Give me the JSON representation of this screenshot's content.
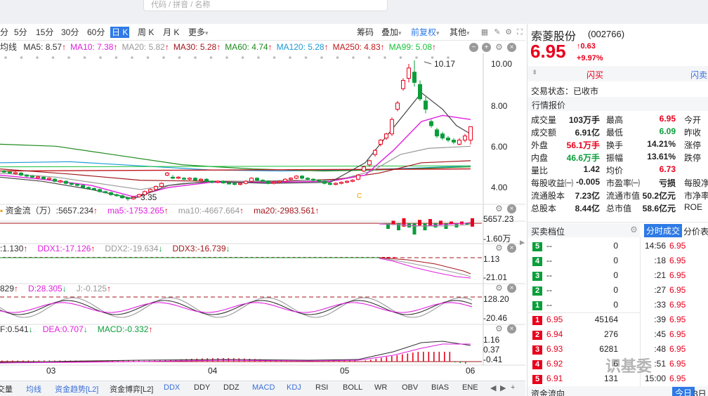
{
  "search": {
    "placeholder": "代码 / 拼音 / 名称"
  },
  "toolbar": {
    "periods": [
      "分",
      "5分",
      "15分",
      "30分",
      "60分",
      "日 K",
      "周 K",
      "月 K",
      "更多"
    ],
    "active_period": "日 K",
    "tools": [
      "筹码",
      "叠加",
      "前复权",
      "其他"
    ],
    "more_caret": "▾"
  },
  "ma_row": {
    "lead": "均线",
    "items": [
      {
        "label": "MA5: 8.57",
        "arrow": "↑",
        "color": "#333333"
      },
      {
        "label": "MA10: 7.38",
        "arrow": "↑",
        "color": "#e01ee0"
      },
      {
        "label": "MA20: 5.82",
        "arrow": "↑",
        "color": "#999999"
      },
      {
        "label": "MA30: 5.28",
        "arrow": "↑",
        "color": "#a3171c"
      },
      {
        "label": "MA60: 4.74",
        "arrow": "↑",
        "color": "#1d8a1d"
      },
      {
        "label": "MA120: 5.28",
        "arrow": "↑",
        "color": "#1a9ad6"
      },
      {
        "label": "MA250: 4.83",
        "arrow": "↑",
        "color": "#c2181d"
      },
      {
        "label": "MA99: 5.08",
        "arrow": "↑",
        "color": "#18c03a"
      }
    ]
  },
  "main_chart": {
    "y_ticks": [
      "10.00",
      "8.00",
      "6.00",
      "4.00"
    ],
    "high_annotation": "10.17",
    "low_annotation": "3.35",
    "marker_c": "C",
    "x_ticks": [
      "03",
      "04",
      "05",
      "06"
    ]
  },
  "fund_flow": {
    "items": [
      {
        "label": "资金流（万）:5657.234",
        "arrow": "↑",
        "color": "#333333"
      },
      {
        "label": "ma5:-1753.265",
        "arrow": "↑",
        "color": "#e01ee0"
      },
      {
        "label": "ma10:-4667.664",
        "arrow": "↑",
        "color": "#999999"
      },
      {
        "label": "ma20:-2983.561",
        "arrow": "↑",
        "color": "#a3171c"
      }
    ],
    "y_ticks": [
      "5657.23",
      "-1.60万"
    ]
  },
  "ddx": {
    "items": [
      {
        "label": ":1.130",
        "arrow": "↑",
        "color": "#333333"
      },
      {
        "label": "DDX1:-17.126",
        "arrow": "↑",
        "color": "#e01ee0"
      },
      {
        "label": "DDX2:-19.634",
        "arrow": "↓",
        "color": "#999999"
      },
      {
        "label": "DDX3:-16.739",
        "arrow": "↓",
        "color": "#a3171c"
      }
    ],
    "y_ticks": [
      "1.13",
      "-21.01"
    ]
  },
  "kdj": {
    "items": [
      {
        "label": "829",
        "arrow": "↑",
        "color": "#333333"
      },
      {
        "label": "D:28.305",
        "arrow": "↓",
        "color": "#e01ee0"
      },
      {
        "label": "J:-0.125",
        "arrow": "↑",
        "color": "#999999"
      }
    ],
    "y_ticks": [
      "128.20",
      "-20.46"
    ]
  },
  "macd": {
    "items": [
      {
        "label": "F:0.541",
        "arrow": "↓",
        "color": "#333333"
      },
      {
        "label": "DEA:0.707",
        "arrow": "↓",
        "color": "#e01ee0"
      },
      {
        "label": "MACD:-0.332",
        "arrow": "↑",
        "color": "#0a9e3a"
      }
    ],
    "y_ticks": [
      "1.16",
      "0.37",
      "-0.41"
    ]
  },
  "bottom_tabs": [
    "交量",
    "均线",
    "资金趋势[L2]",
    "资金博弈[L2]",
    "DDX",
    "DDY",
    "DDZ",
    "MACD",
    "KDJ",
    "RSI",
    "BOLL",
    "WR",
    "OBV",
    "BIAS",
    "ENE"
  ],
  "stock": {
    "name": "索菱股份",
    "code": "(002766)",
    "price": "6.95",
    "change": "0.63",
    "change_arrow": "↑",
    "change_pct": "+9.97%",
    "buy_btn": "闪买",
    "sell_btn": "闪卖",
    "status_label": "交易状态：已收市",
    "quote_title": "行情报价"
  },
  "quote": [
    [
      {
        "k": "成交量",
        "v": "103万手",
        "c": "#222222"
      },
      {
        "k": "最高",
        "v": "6.95",
        "c": "#e8001c"
      },
      {
        "k": "今开",
        "v": "",
        "c": "#222222"
      }
    ],
    [
      {
        "k": "成交额",
        "v": "6.91亿",
        "c": "#222222"
      },
      {
        "k": "最低",
        "v": "6.09",
        "c": "#0a9e3a"
      },
      {
        "k": "昨收",
        "v": "",
        "c": "#222222"
      }
    ],
    [
      {
        "k": "外盘",
        "v": "56.1万手",
        "c": "#e8001c"
      },
      {
        "k": "换手",
        "v": "14.21%",
        "c": "#222222"
      },
      {
        "k": "涨停",
        "v": "",
        "c": "#222222"
      }
    ],
    [
      {
        "k": "内盘",
        "v": "46.6万手",
        "c": "#0a9e3a"
      },
      {
        "k": "振幅",
        "v": "13.61%",
        "c": "#222222"
      },
      {
        "k": "跌停",
        "v": "",
        "c": "#222222"
      }
    ],
    [
      {
        "k": "量比",
        "v": "1.42",
        "c": "#222222"
      },
      {
        "k": "均价",
        "v": "6.73",
        "c": "#e8001c"
      },
      {
        "k": "",
        "v": "",
        "c": "#222222"
      }
    ],
    [
      {
        "k": "每股收益㈠",
        "v": "-0.005",
        "c": "#222222"
      },
      {
        "k": "市盈率㈠",
        "v": "亏损",
        "c": "#222222"
      },
      {
        "k": "每股净",
        "v": "",
        "c": "#222222"
      }
    ],
    [
      {
        "k": "流通股本",
        "v": "7.23亿",
        "c": "#222222"
      },
      {
        "k": "流通市值",
        "v": "50.2亿元",
        "c": "#222222"
      },
      {
        "k": "市净率",
        "v": "",
        "c": "#222222"
      }
    ],
    [
      {
        "k": "总股本",
        "v": "8.44亿",
        "c": "#222222"
      },
      {
        "k": "总市值",
        "v": "58.6亿元",
        "c": "#222222"
      },
      {
        "k": "ROE",
        "v": "",
        "c": "#222222"
      }
    ]
  ],
  "order_book": {
    "title": "买卖档位",
    "tab_trades": "分时成交",
    "tab_price": "分价表",
    "sell": [
      {
        "lvl": "5",
        "price": "--",
        "vol": "0"
      },
      {
        "lvl": "4",
        "price": "--",
        "vol": "0"
      },
      {
        "lvl": "3",
        "price": "--",
        "vol": "0"
      },
      {
        "lvl": "2",
        "price": "--",
        "vol": "0"
      },
      {
        "lvl": "1",
        "price": "--",
        "vol": "0"
      }
    ],
    "buy": [
      {
        "lvl": "1",
        "price": "6.95",
        "vol": "45164"
      },
      {
        "lvl": "2",
        "price": "6.94",
        "vol": "276"
      },
      {
        "lvl": "3",
        "price": "6.93",
        "vol": "6281"
      },
      {
        "lvl": "4",
        "price": "6.92",
        "vol": "6"
      },
      {
        "lvl": "5",
        "price": "6.91",
        "vol": "131"
      }
    ],
    "trades": [
      {
        "t": "14:56",
        "p": "6.95"
      },
      {
        "t": ":18",
        "p": "6.95"
      },
      {
        "t": ":21",
        "p": "6.95"
      },
      {
        "t": ":27",
        "p": "6.95"
      },
      {
        "t": ":33",
        "p": "6.95"
      },
      {
        "t": ":39",
        "p": "6.95"
      },
      {
        "t": ":45",
        "p": "6.95"
      },
      {
        "t": ":48",
        "p": "6.95"
      },
      {
        "t": ":51",
        "p": "6.95"
      },
      {
        "t": "15:00",
        "p": "6.95"
      }
    ]
  },
  "funds_flow_title": "资金流向",
  "today_tab": "今日",
  "three_day": "3日",
  "watermark": "识基委",
  "colors": {
    "up": "#e8001c",
    "down": "#0a9e3a",
    "accent": "#2e7ae6"
  }
}
